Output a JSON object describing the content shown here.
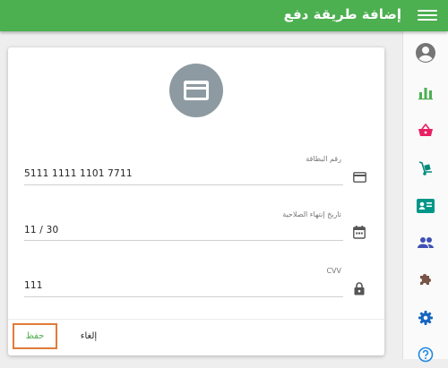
{
  "appbar": {
    "title": "إضافة طريقة دفع",
    "menu_icon": "hamburger-menu-icon"
  },
  "sidebar": {
    "items": [
      {
        "name": "account-icon",
        "color": "#757575"
      },
      {
        "name": "bar-chart-icon",
        "color": "#4caf50"
      },
      {
        "name": "shopping-basket-icon",
        "color": "#e91e63"
      },
      {
        "name": "hand-truck-icon",
        "color": "#00897b"
      },
      {
        "name": "contact-card-icon",
        "color": "#009688"
      },
      {
        "name": "people-icon",
        "color": "#3f51b5"
      },
      {
        "name": "puzzle-icon",
        "color": "#795548"
      },
      {
        "name": "settings-icon",
        "color": "#1565c0"
      },
      {
        "name": "help-icon",
        "color": "#1e88e5"
      }
    ]
  },
  "card": {
    "avatar_icon": "credit-card-icon",
    "fields": [
      {
        "label": "رقم البطاقة",
        "value": "5111 1111 1101 7711",
        "icon": "credit-card-icon"
      },
      {
        "label": "تاريخ إنتهاء الصلاحية",
        "value": "11 / 30",
        "icon": "calendar-icon"
      },
      {
        "label": "CVV",
        "value": "111",
        "icon": "lock-icon"
      }
    ],
    "actions": {
      "save_label": "حفظ",
      "cancel_label": "إلغاء"
    }
  },
  "colors": {
    "primary": "#4caf50",
    "focus_outline": "#e07b39",
    "avatar_bg": "#8d9aa1"
  }
}
